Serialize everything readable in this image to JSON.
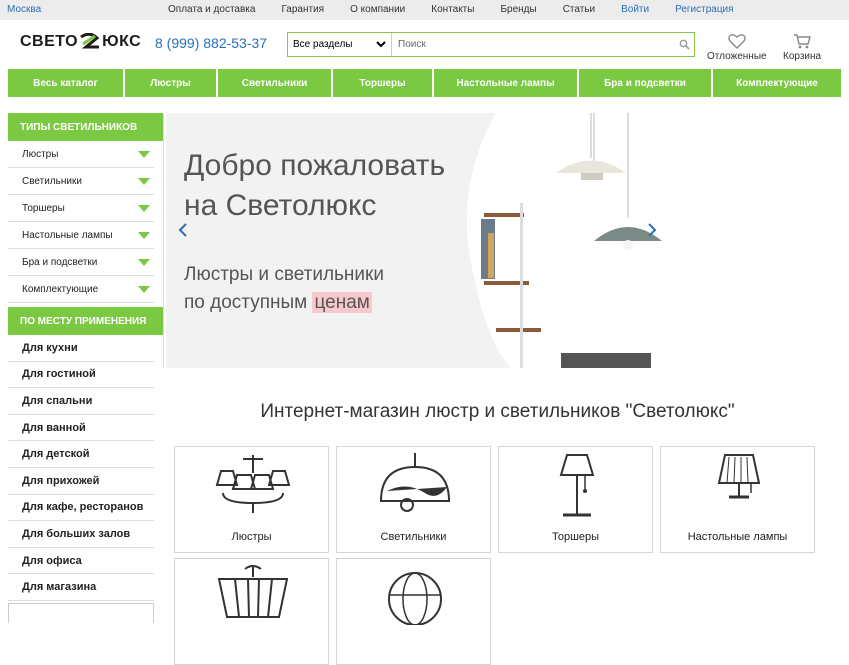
{
  "topbar": {
    "city": "Москва",
    "links": [
      "Оплата и доставка",
      "Гарантия",
      "О компании",
      "Контакты",
      "Бренды",
      "Статьи"
    ],
    "login": "Войти",
    "register": "Регистрация"
  },
  "header": {
    "logo_left": "СВЕТО",
    "logo_right": "ЮКС",
    "phone": "8 (999) 882-53-37",
    "search_section": "Все разделы",
    "search_placeholder": "Поиск",
    "saved_label": "Отложенные",
    "cart_label": "Корзина"
  },
  "nav": [
    "Весь каталог",
    "Люстры",
    "Светильники",
    "Торшеры",
    "Настольные лампы",
    "Бра и подсветки",
    "Комплектующие"
  ],
  "sidebar": {
    "types_title": "ТИПЫ СВЕТИЛЬНИКОВ",
    "types": [
      "Люстры",
      "Светильники",
      "Торшеры",
      "Настольные лампы",
      "Бра и подсветки",
      "Комплектующие"
    ],
    "places_title": "ПО МЕСТУ ПРИМЕНЕНИЯ",
    "places": [
      "Для кухни",
      "Для гостиной",
      "Для спальни",
      "Для ванной",
      "Для детской",
      "Для прихожей",
      "Для кафе, ресторанов",
      "Для больших залов",
      "Для офиса",
      "Для магазина"
    ]
  },
  "banner": {
    "line1": "Добро пожаловать",
    "line2": "на Светолюкс",
    "sub1": "Люстры и светильники",
    "sub2_pre": "по доступным",
    "sub2_hl": "ценам"
  },
  "main_title": "Интернет-магазин люстр и светильников \"Светолюкс\"",
  "categories": [
    "Люстры",
    "Светильники",
    "Торшеры",
    "Настольные лампы",
    "",
    ""
  ]
}
